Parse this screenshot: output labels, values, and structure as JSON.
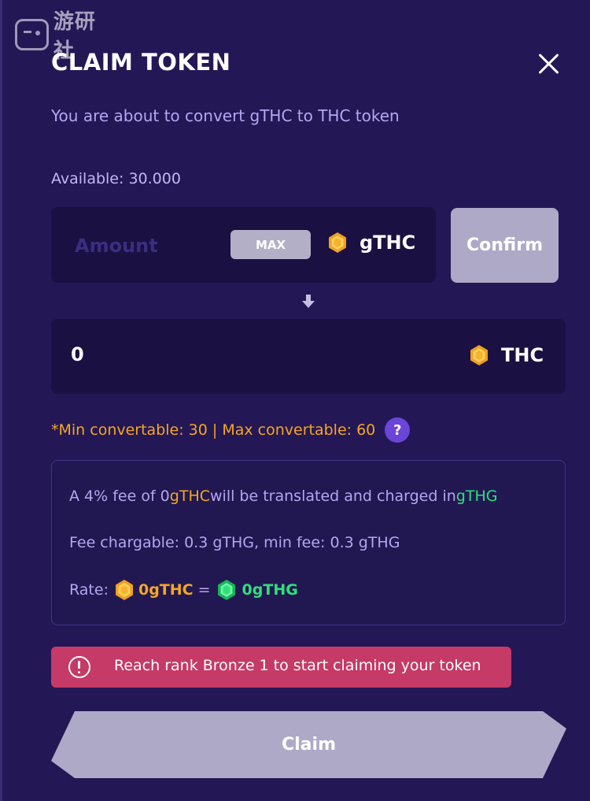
{
  "watermark": {
    "text": "游研社"
  },
  "header": {
    "title": "CLAIM TOKEN"
  },
  "subtitle": "You are about to convert gTHC to THC token",
  "available": {
    "label": "Available:",
    "value": "30.000"
  },
  "amount": {
    "placeholder": "Amount",
    "max_label": "MAX",
    "token": "gTHC"
  },
  "confirm_label": "Confirm",
  "output": {
    "value": "0",
    "token": "THC"
  },
  "limits": {
    "text": "*Min convertable: 30 | Max convertable: 60",
    "help": "?"
  },
  "info": {
    "line1": {
      "prefix": "A 4% fee of 0 ",
      "token1": "gTHC",
      "middle": " will be translated and charged in ",
      "token2": "gTHG"
    },
    "line2": "Fee chargable: 0.3  gTHG, min fee: 0.3 gTHG",
    "line3": {
      "label": "Rate:",
      "left": "0gTHC",
      "equals": "=",
      "right": "0gTHG"
    }
  },
  "warning": {
    "text": "Reach rank Bronze 1 to start claiming your token"
  },
  "claim_label": "Claim",
  "colors": {
    "bg": "#241756",
    "accent_orange": "#f5a623",
    "accent_green": "#2fe07a",
    "warning": "#c53a66",
    "help": "#6a45d8"
  }
}
